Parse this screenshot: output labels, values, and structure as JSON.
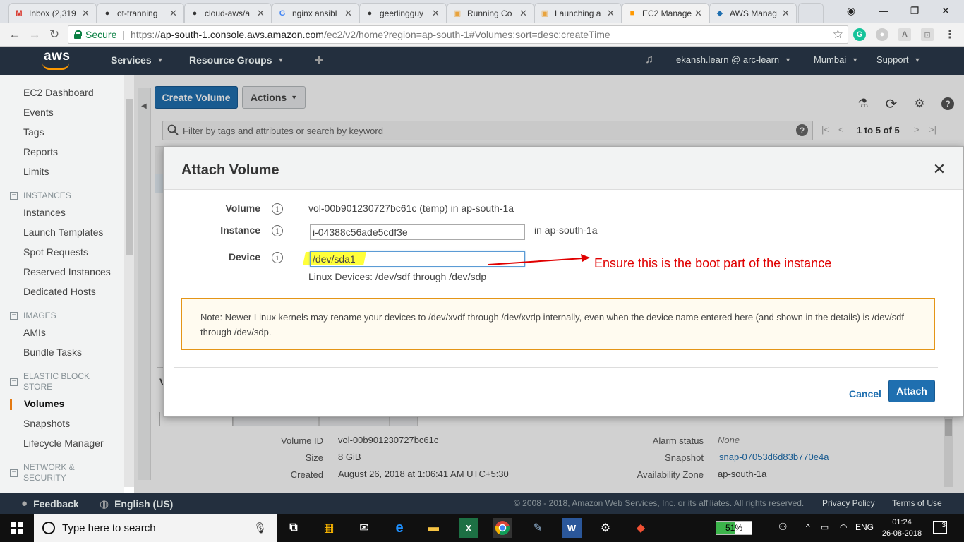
{
  "browser": {
    "tabs": [
      {
        "title": "Inbox (2,319",
        "favicon": "gmail-icon"
      },
      {
        "title": "ot-tranning",
        "favicon": "github-icon"
      },
      {
        "title": "cloud-aws/a",
        "favicon": "github-icon"
      },
      {
        "title": "nginx ansibl",
        "favicon": "google-icon"
      },
      {
        "title": "geerlingguy",
        "favicon": "github-icon"
      },
      {
        "title": "Running Co",
        "favicon": "document-icon"
      },
      {
        "title": "Launching a",
        "favicon": "document-icon"
      },
      {
        "title": "EC2 Manage",
        "favicon": "aws-icon"
      },
      {
        "title": "AWS Manag",
        "favicon": "aws-icon"
      }
    ],
    "secure_label": "Secure",
    "url_prefix": "https://",
    "url_host": "ap-south-1.console.aws.amazon.com",
    "url_path": "/ec2/v2/home?region=ap-south-1#Volumes:sort=desc:createTime"
  },
  "aws_nav": {
    "logo_text": "aws",
    "services": "Services",
    "resource_groups": "Resource Groups",
    "account": "ekansh.learn @ arc-learn",
    "region": "Mumbai",
    "support": "Support"
  },
  "sidebar": {
    "top_items": [
      "EC2 Dashboard",
      "Events",
      "Tags",
      "Reports",
      "Limits"
    ],
    "sections": [
      {
        "heading": "INSTANCES",
        "items": [
          "Instances",
          "Launch Templates",
          "Spot Requests",
          "Reserved Instances",
          "Dedicated Hosts"
        ]
      },
      {
        "heading": "IMAGES",
        "items": [
          "AMIs",
          "Bundle Tasks"
        ]
      },
      {
        "heading": "ELASTIC BLOCK STORE",
        "items": [
          "Volumes",
          "Snapshots",
          "Lifecycle Manager"
        ]
      },
      {
        "heading": "NETWORK & SECURITY",
        "items": []
      }
    ],
    "active_item": "Volumes"
  },
  "toolbar": {
    "create_volume": "Create Volume",
    "actions": "Actions",
    "filter_placeholder": "Filter by tags and attributes or search by keyword",
    "pagination": "1 to 5 of 5"
  },
  "details": {
    "volume_id_label": "Volume ID",
    "volume_id": "vol-00b901230727bc61c",
    "size_label": "Size",
    "size": "8 GiB",
    "created_label": "Created",
    "created": "August 26, 2018 at 1:06:41 AM UTC+5:30",
    "alarm_label": "Alarm status",
    "alarm": "None",
    "snapshot_label": "Snapshot",
    "snapshot": "snap-07053d6d83b770e4a",
    "az_label": "Availability Zone",
    "az": "ap-south-1a",
    "partial_heading": "V"
  },
  "modal": {
    "title": "Attach Volume",
    "volume_label": "Volume",
    "volume_value": "vol-00b901230727bc61c (temp) in ap-south-1a",
    "instance_label": "Instance",
    "instance_value": "i-04388c56ade5cdf3e",
    "instance_suffix": "in ap-south-1a",
    "device_label": "Device",
    "device_value": "/dev/sda1",
    "device_hint": "Linux Devices: /dev/sdf through /dev/sdp",
    "note": "Note: Newer Linux kernels may rename your devices to /dev/xvdf through /dev/xvdp internally, even when the device name entered here (and shown in the details) is /dev/sdf through /dev/sdp.",
    "cancel": "Cancel",
    "attach": "Attach"
  },
  "annotation": "Ensure this is the boot part of the instance",
  "footer": {
    "feedback": "Feedback",
    "language": "English (US)",
    "copyright": "© 2008 - 2018, Amazon Web Services, Inc. or its affiliates. All rights reserved.",
    "privacy": "Privacy Policy",
    "terms": "Terms of Use"
  },
  "taskbar": {
    "search_placeholder": "Type here to search",
    "battery": "51%",
    "battery_level": 0.51,
    "language": "ENG",
    "time": "01:24",
    "date": "26-08-2018",
    "notifications": "3"
  },
  "colors": {
    "aws_nav": "#232f3e",
    "aws_orange": "#ff9900",
    "primary_button": "#1f6fb0",
    "annotation_red": "#e00000",
    "highlight_yellow": "#ffff3a"
  }
}
